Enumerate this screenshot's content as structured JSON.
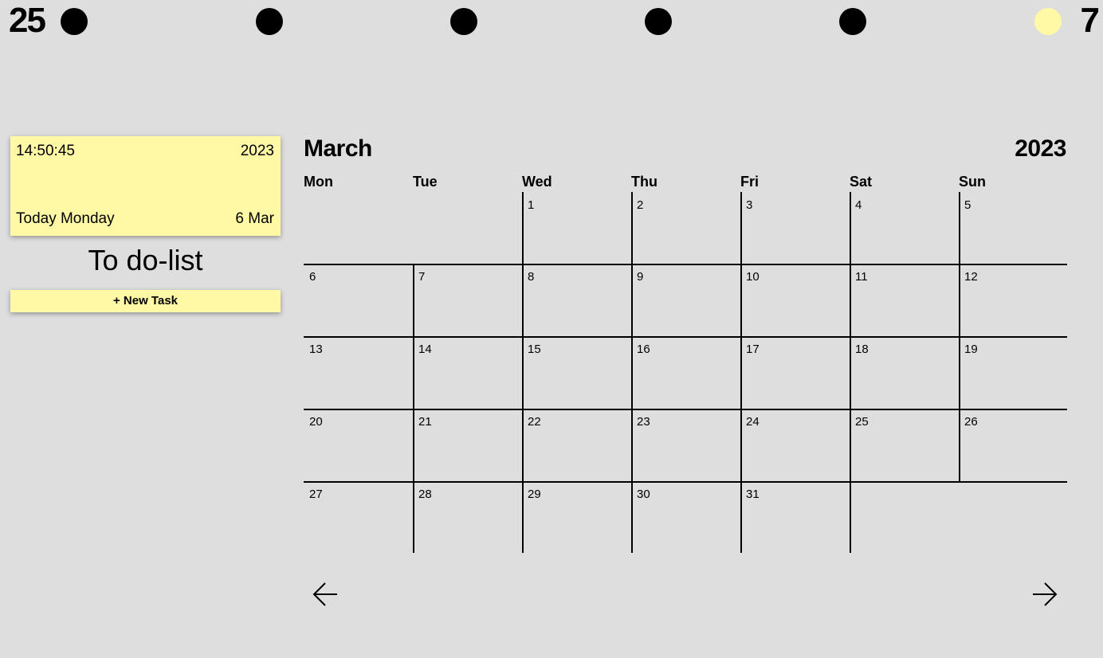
{
  "topbar": {
    "left_number": "25",
    "right_number": "7",
    "dot_icons": [
      "circle-filled",
      "circle-filled",
      "circle-filled",
      "circle-filled",
      "circle-filled",
      "circle-today"
    ],
    "colors": {
      "dot": "#000000",
      "today_dot": "#fff9a6"
    }
  },
  "clock": {
    "time": "14:50:45",
    "year": "2023",
    "day_label": "Today Monday",
    "date": "6 Mar"
  },
  "todo": {
    "title": "To do-list",
    "new_task_label": "+ New Task"
  },
  "calendar": {
    "month": "March",
    "year": "2023",
    "weekdays": [
      "Mon",
      "Tue",
      "Wed",
      "Thu",
      "Fri",
      "Sat",
      "Sun"
    ],
    "weeks": [
      [
        "",
        "",
        "1",
        "2",
        "3",
        "4",
        "5"
      ],
      [
        "6",
        "7",
        "8",
        "9",
        "10",
        "11",
        "12"
      ],
      [
        "13",
        "14",
        "15",
        "16",
        "17",
        "18",
        "19"
      ],
      [
        "20",
        "21",
        "22",
        "23",
        "24",
        "25",
        "26"
      ],
      [
        "27",
        "28",
        "29",
        "30",
        "31",
        "",
        ""
      ]
    ],
    "prev_icon": "arrow-left-icon",
    "next_icon": "arrow-right-icon"
  },
  "colors": {
    "background": "#dedede",
    "accent": "#fff9a6"
  }
}
